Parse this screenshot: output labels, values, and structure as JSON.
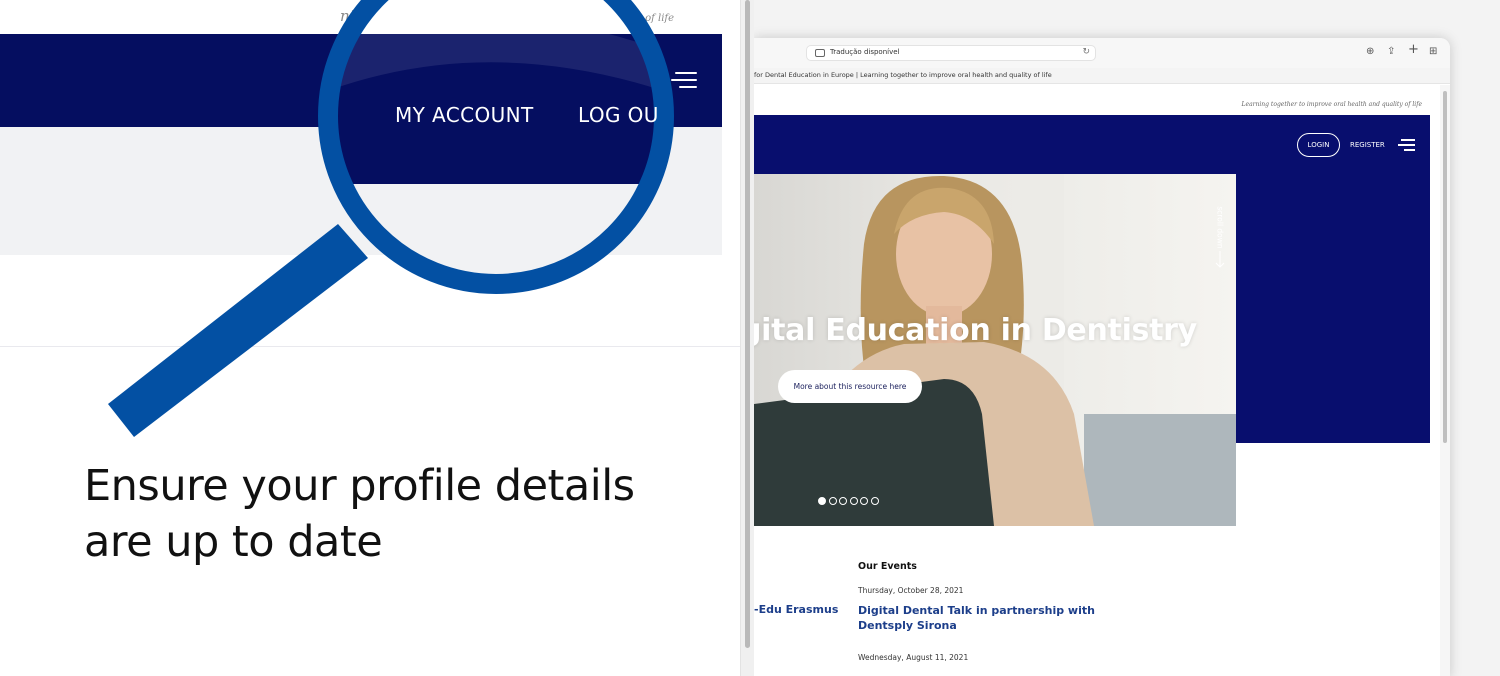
{
  "left": {
    "tagline": "ning together to improve oral hea",
    "tagline_tail": "d quality of life",
    "nav": {
      "my_account": "MY ACCOUNT",
      "log_out": "LOG OU"
    },
    "headline_line1": "Ensure your profile details",
    "headline_line2": "are up to date"
  },
  "browser": {
    "url_text": "Tradução disponível",
    "tab_title": "for Dental Education in Europe | Learning together to improve oral health and quality of life"
  },
  "site": {
    "tagline": "Learning together to improve oral health and quality of life",
    "login_label": "LOGIN",
    "register_label": "REGISTER",
    "scroll_down_label": "scroll down",
    "hero_title": "igital Education in Dentistry",
    "more_button_label": "More about this resource here",
    "slider": {
      "count": 6,
      "active": 0
    },
    "events_title": "Our Events",
    "events": [
      {
        "date": "Thursday, October 28, 2021",
        "title": "Digital Dental Talk in partnership with Dentsply Sirona"
      },
      {
        "date": "Wednesday, August 11, 2021",
        "title": ""
      }
    ],
    "left_event_fragment": "-Edu Erasmus"
  },
  "colors": {
    "navy": "#050e60",
    "hero_navy": "#080e6e",
    "magnifier_blue": "#0350a3",
    "link_blue": "#1c3e8a"
  },
  "icons": [
    "hamburger-menu-icon",
    "magnifier-icon",
    "translate-icon",
    "reload-icon",
    "download-icon",
    "share-icon",
    "new-tab-icon",
    "tab-grid-icon",
    "scroll-down-arrow-icon",
    "slider-dot-icon"
  ]
}
